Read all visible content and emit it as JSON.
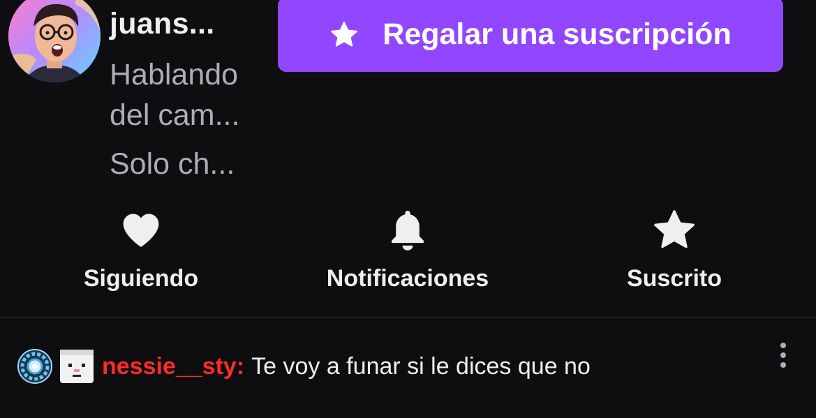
{
  "channel": {
    "name": "juans...",
    "title_lines": [
      "Hablando",
      "del cam..."
    ],
    "category": "Solo ch..."
  },
  "gift_button": {
    "label": "Regalar una suscripción",
    "icon": "star-icon"
  },
  "actions": [
    {
      "label": "Siguiendo",
      "icon": "heart-icon"
    },
    {
      "label": "Notificaciones",
      "icon": "bell-icon"
    },
    {
      "label": "Suscrito",
      "icon": "star-icon"
    }
  ],
  "chat": {
    "badges": [
      "arc-reactor-badge-icon",
      "pixel-face-badge-icon"
    ],
    "username": "nessie__sty",
    "colon": ":",
    "message": "Te voy a funar si le dices que no",
    "more_icon": "more-vertical-icon"
  },
  "colors": {
    "background": "#0e0e10",
    "accent": "#9147ff",
    "muted_text": "#adadb8",
    "username": "#ff2a2a",
    "divider": "#2f2f35"
  }
}
